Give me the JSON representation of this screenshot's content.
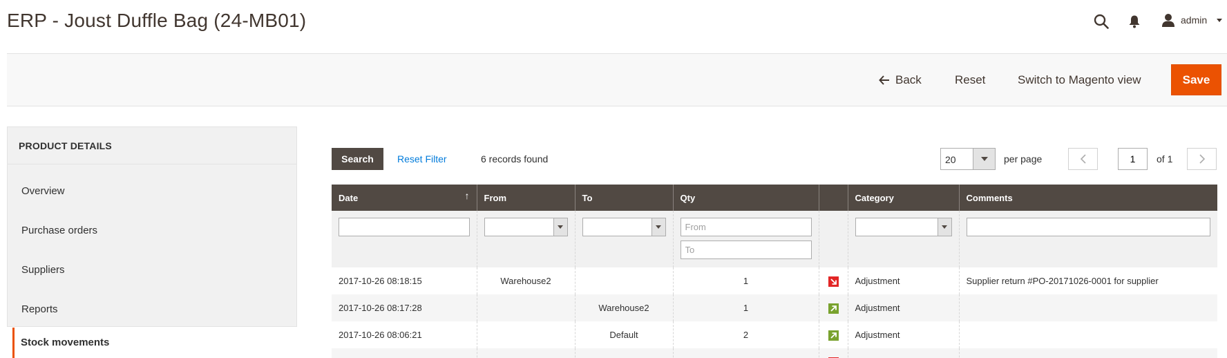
{
  "header": {
    "title": "ERP - Joust Duffle Bag (24-MB01)",
    "user_name": "admin"
  },
  "toolbar": {
    "back_label": "Back",
    "reset_label": "Reset",
    "switch_label": "Switch to Magento view",
    "save_label": "Save"
  },
  "sidebar": {
    "title": "PRODUCT DETAILS",
    "items": [
      {
        "label": "Overview"
      },
      {
        "label": "Purchase orders"
      },
      {
        "label": "Suppliers"
      },
      {
        "label": "Reports"
      },
      {
        "label": "Stock movements",
        "active": true
      }
    ]
  },
  "grid": {
    "search_label": "Search",
    "reset_filter_label": "Reset Filter",
    "records_found": "6 records found",
    "per_page_value": "20",
    "per_page_label": "per page",
    "page_value": "1",
    "page_of": "of 1",
    "columns": [
      "Date",
      "From",
      "To",
      "Qty",
      "",
      "Category",
      "Comments"
    ],
    "filters": {
      "qty_from_placeholder": "From",
      "qty_to_placeholder": "To"
    },
    "rows": [
      {
        "date": "2017-10-26 08:18:15",
        "from": "Warehouse2",
        "to": "",
        "qty": "1",
        "direction": "out",
        "category": "Adjustment",
        "comments": "Supplier return #PO-20171026-0001 for supplier"
      },
      {
        "date": "2017-10-26 08:17:28",
        "from": "",
        "to": "Warehouse2",
        "qty": "1",
        "direction": "in",
        "category": "Adjustment",
        "comments": ""
      },
      {
        "date": "2017-10-26 08:06:21",
        "from": "",
        "to": "Default",
        "qty": "2",
        "direction": "in",
        "category": "Adjustment",
        "comments": ""
      },
      {
        "date": "",
        "from": "",
        "to": "",
        "qty": "",
        "direction": "out",
        "category": "",
        "comments": ""
      }
    ]
  },
  "colors": {
    "accent": "#eb5202",
    "table_header": "#514943",
    "link": "#007bdb",
    "in_icon": "#79a22e",
    "out_icon": "#e22626"
  }
}
